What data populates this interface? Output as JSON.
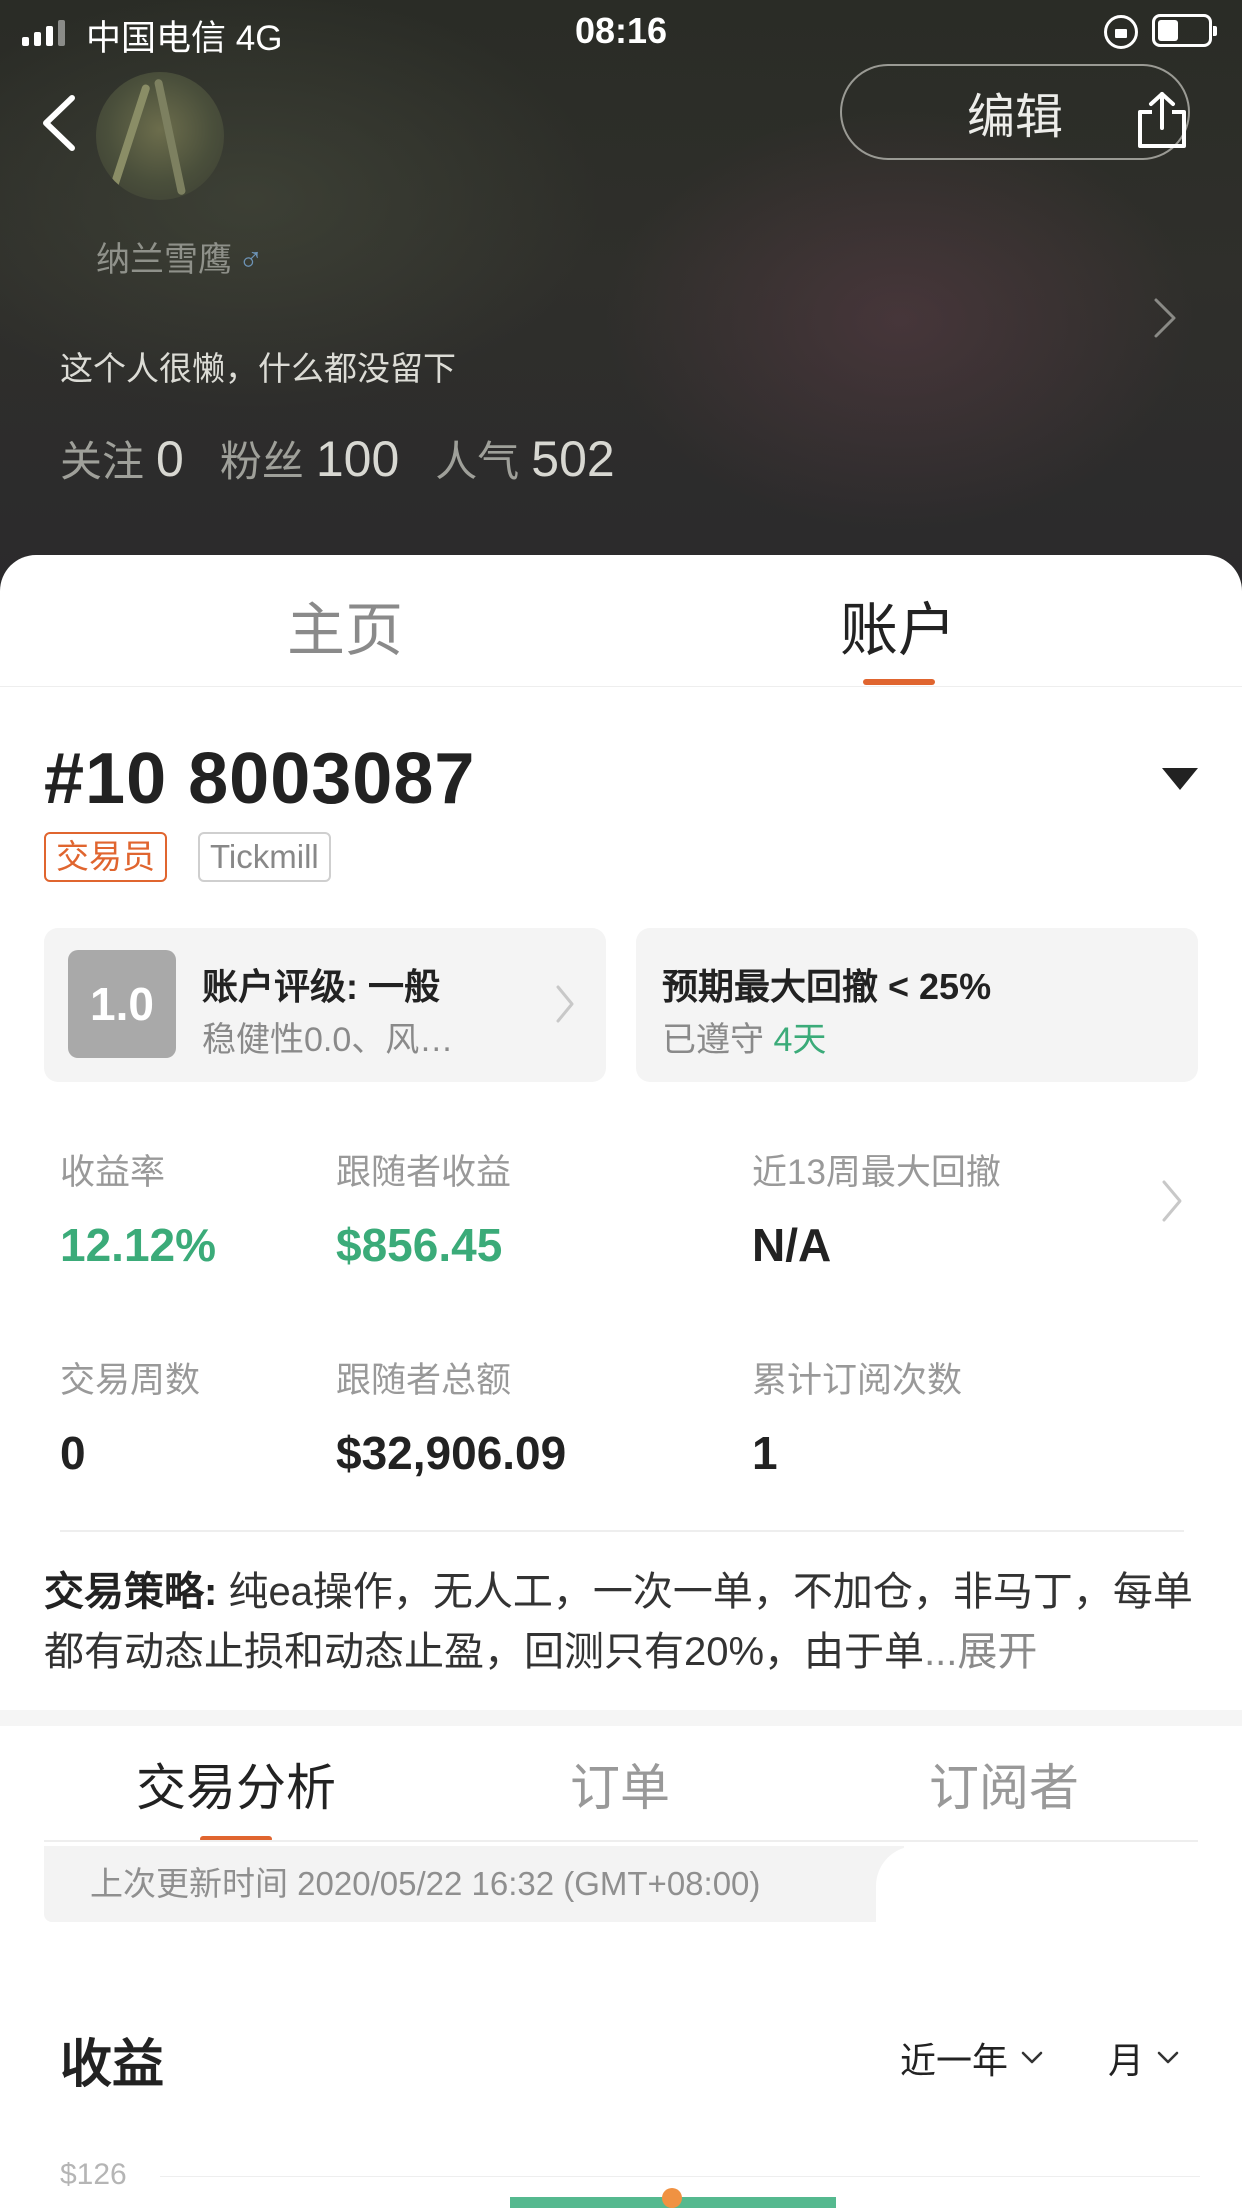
{
  "status_bar": {
    "carrier": "中国电信  4G",
    "time": "08:16"
  },
  "profile": {
    "nickname": "纳兰雪鹰",
    "gender_symbol": "♂",
    "bio": "这个人很懒，什么都没留下",
    "edit_label": "编辑",
    "stats": [
      {
        "label": "关注",
        "value": "0"
      },
      {
        "label": "粉丝",
        "value": "100"
      },
      {
        "label": "人气",
        "value": "502"
      }
    ]
  },
  "tabs": {
    "home": "主页",
    "account": "账户",
    "active": "账户"
  },
  "account": {
    "id": "#10 8003087",
    "tags": [
      "交易员",
      "Tickmill"
    ],
    "rating_card": {
      "score": "1.0",
      "title": "账户评级: 一般",
      "subtitle": "稳健性0.0、风…"
    },
    "drawdown_card": {
      "title": "预期最大回撤 < 25%",
      "subtitle_prefix": "已遵守",
      "subtitle_value": "4天"
    },
    "metrics": [
      {
        "label": "收益率",
        "value": "12.12%"
      },
      {
        "label": "跟随者收益",
        "value": "$856.45"
      },
      {
        "label": "近13周最大回撤",
        "value": "N/A"
      },
      {
        "label": "交易周数",
        "value": "0"
      },
      {
        "label": "跟随者总额",
        "value": "$32,906.09"
      },
      {
        "label": "累计订阅次数",
        "value": "1"
      }
    ],
    "strategy": {
      "label": "交易策略:",
      "text": " 纯ea操作，无人工，一次一单，不加仓，非马丁，每单都有动态止损和动态止盈，回测只有20%，由于单",
      "ellipsis": "...",
      "expand": "展开"
    }
  },
  "sub_tabs": {
    "analysis": "交易分析",
    "orders": "订单",
    "subscribers": "订阅者",
    "active": "交易分析"
  },
  "update_text": "上次更新时间 2020/05/22 16:32 (GMT+08:00)",
  "earnings": {
    "title": "收益",
    "range": "近一年",
    "period": "月",
    "y_tick": "$126"
  },
  "colors": {
    "accent": "#e0652f",
    "positive": "#3bab79"
  }
}
